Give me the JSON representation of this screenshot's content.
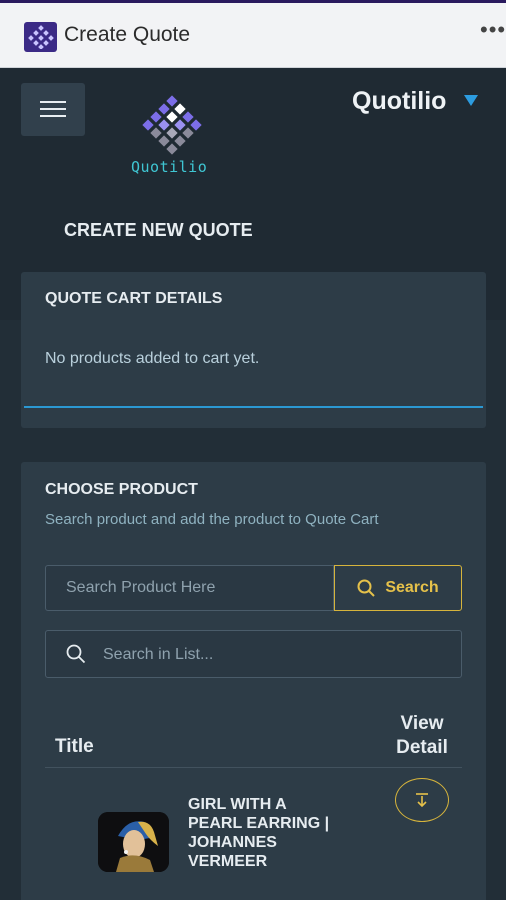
{
  "window": {
    "title": "Create Quote",
    "more_icon": "more-horizontal-icon"
  },
  "header": {
    "menu_icon": "hamburger-menu-icon",
    "logo_text": "Quotilio",
    "brand": "Quotilio",
    "brand_caret_icon": "caret-down-icon"
  },
  "page": {
    "heading": "CREATE NEW QUOTE"
  },
  "cart": {
    "title": "QUOTE CART DETAILS",
    "empty_message": "No products added to cart yet."
  },
  "product": {
    "title": "CHOOSE PRODUCT",
    "subtitle": "Search product and add the product to Quote Cart",
    "search_placeholder": "Search Product Here",
    "search_button": "Search",
    "list_search_placeholder": "Search in List...",
    "columns": {
      "title": "Title",
      "view_detail": "View Detail"
    },
    "rows": [
      {
        "title": "GIRL WITH A PEARL EARRING | JOHANNES VERMEER",
        "action_icon": "download-arrow-icon"
      }
    ]
  },
  "colors": {
    "accent": "#d6b43c",
    "link_blue": "#2b98d2",
    "brand_cyan": "#3fc6d3",
    "background": "#222e37"
  }
}
